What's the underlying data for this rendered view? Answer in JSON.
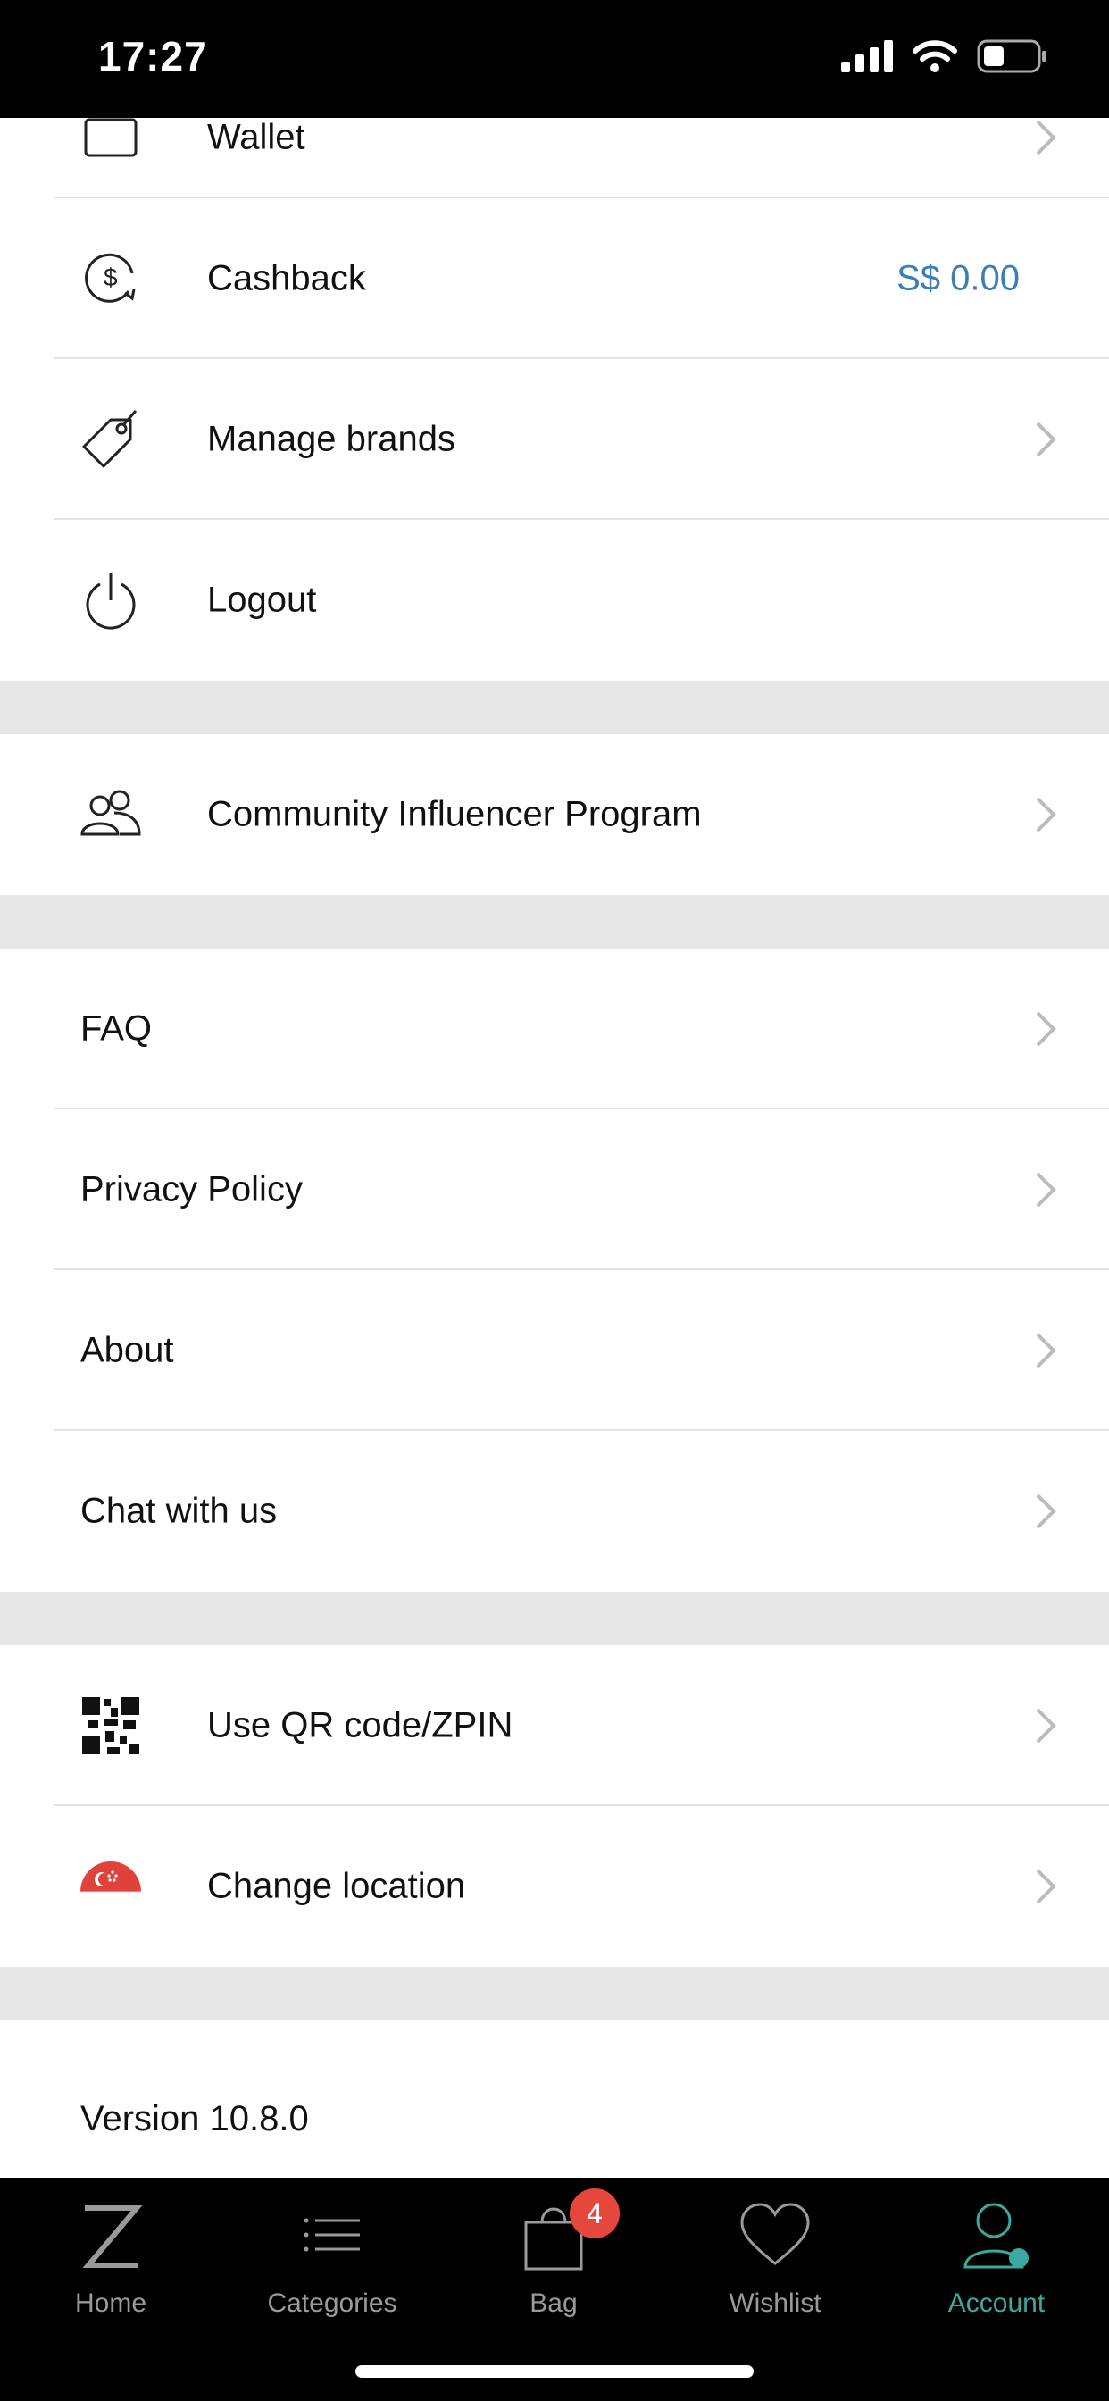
{
  "status_bar": {
    "time": "17:27"
  },
  "menu": {
    "wallet_label": "Wallet",
    "cashback_label": "Cashback",
    "cashback_value": "S$ 0.00",
    "manage_brands_label": "Manage brands",
    "logout_label": "Logout",
    "community_label": "Community Influencer Program",
    "faq_label": "FAQ",
    "privacy_label": "Privacy Policy",
    "about_label": "About",
    "chat_label": "Chat with us",
    "qr_label": "Use QR code/ZPIN",
    "location_label": "Change location",
    "version": "Version 10.8.0"
  },
  "tabs": {
    "home": "Home",
    "categories": "Categories",
    "bag": "Bag",
    "bag_badge": "4",
    "wishlist": "Wishlist",
    "account": "Account"
  },
  "icons": [
    "wallet-icon",
    "cashback-icon",
    "price-tag-icon",
    "power-icon",
    "people-icon",
    "qr-code-icon",
    "singapore-flag-icon",
    "chevron-right-icon",
    "home-logo-icon",
    "list-icon",
    "bag-icon",
    "heart-icon",
    "account-icon"
  ],
  "colors": {
    "accent": "#3aa99f",
    "cashback": "#3b7fb8",
    "badge": "#e5473c"
  }
}
